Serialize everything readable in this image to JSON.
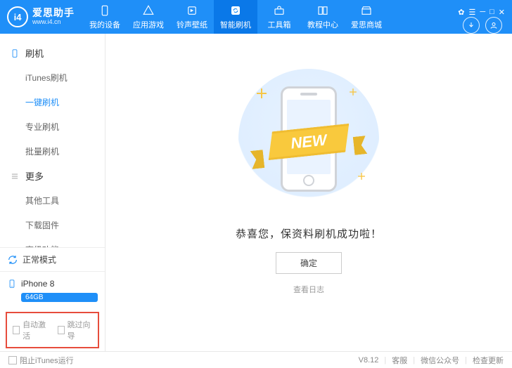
{
  "logo": {
    "badge": "i4",
    "title": "爱思助手",
    "url": "www.i4.cn"
  },
  "nav": [
    {
      "label": "我的设备"
    },
    {
      "label": "应用游戏"
    },
    {
      "label": "铃声壁纸"
    },
    {
      "label": "智能刷机"
    },
    {
      "label": "工具箱"
    },
    {
      "label": "教程中心"
    },
    {
      "label": "爱思商城"
    }
  ],
  "sidebar": {
    "group1": {
      "title": "刷机",
      "items": [
        "iTunes刷机",
        "一键刷机",
        "专业刷机",
        "批量刷机"
      ]
    },
    "group2": {
      "title": "更多",
      "items": [
        "其他工具",
        "下载固件",
        "高级功能"
      ]
    }
  },
  "mode": "正常模式",
  "device": {
    "name": "iPhone 8",
    "storage": "64GB"
  },
  "bottomChecks": {
    "autoActivate": "自动激活",
    "skipWizard": "跳过向导"
  },
  "main": {
    "ribbon": "NEW",
    "success": "恭喜您，保资料刷机成功啦！",
    "ok": "确定",
    "viewLog": "查看日志"
  },
  "statusbar": {
    "blockItunes": "阻止iTunes运行",
    "version": "V8.12",
    "support": "客服",
    "wechat": "微信公众号",
    "update": "检查更新"
  }
}
